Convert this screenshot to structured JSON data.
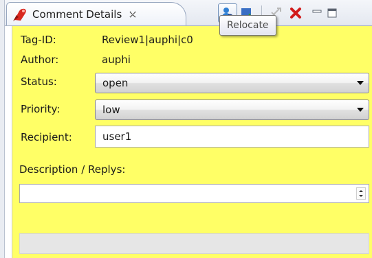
{
  "view": {
    "tab_title": "Comment Details",
    "toolbar_icons": [
      "relocate-icon",
      "add-comment-icon",
      "refresh-icon",
      "delete-icon"
    ],
    "window_icons": [
      "minimize-icon",
      "maximize-icon"
    ]
  },
  "tooltip": {
    "text": "Relocate"
  },
  "fields": {
    "tag_id": {
      "label": "Tag-ID:",
      "value": "Review1|auphi|c0"
    },
    "author": {
      "label": "Author:",
      "value": "auphi"
    },
    "status": {
      "label": "Status:",
      "value": "open"
    },
    "priority": {
      "label": "Priority:",
      "value": "low"
    },
    "recipient": {
      "label": "Recipient:",
      "value": "user1"
    }
  },
  "description": {
    "label": "Description / Replys:",
    "value": ""
  },
  "colors": {
    "panel_bg": "#ffff66",
    "accent_red": "#d11a1a",
    "accent_blue": "#2f7fd3"
  }
}
